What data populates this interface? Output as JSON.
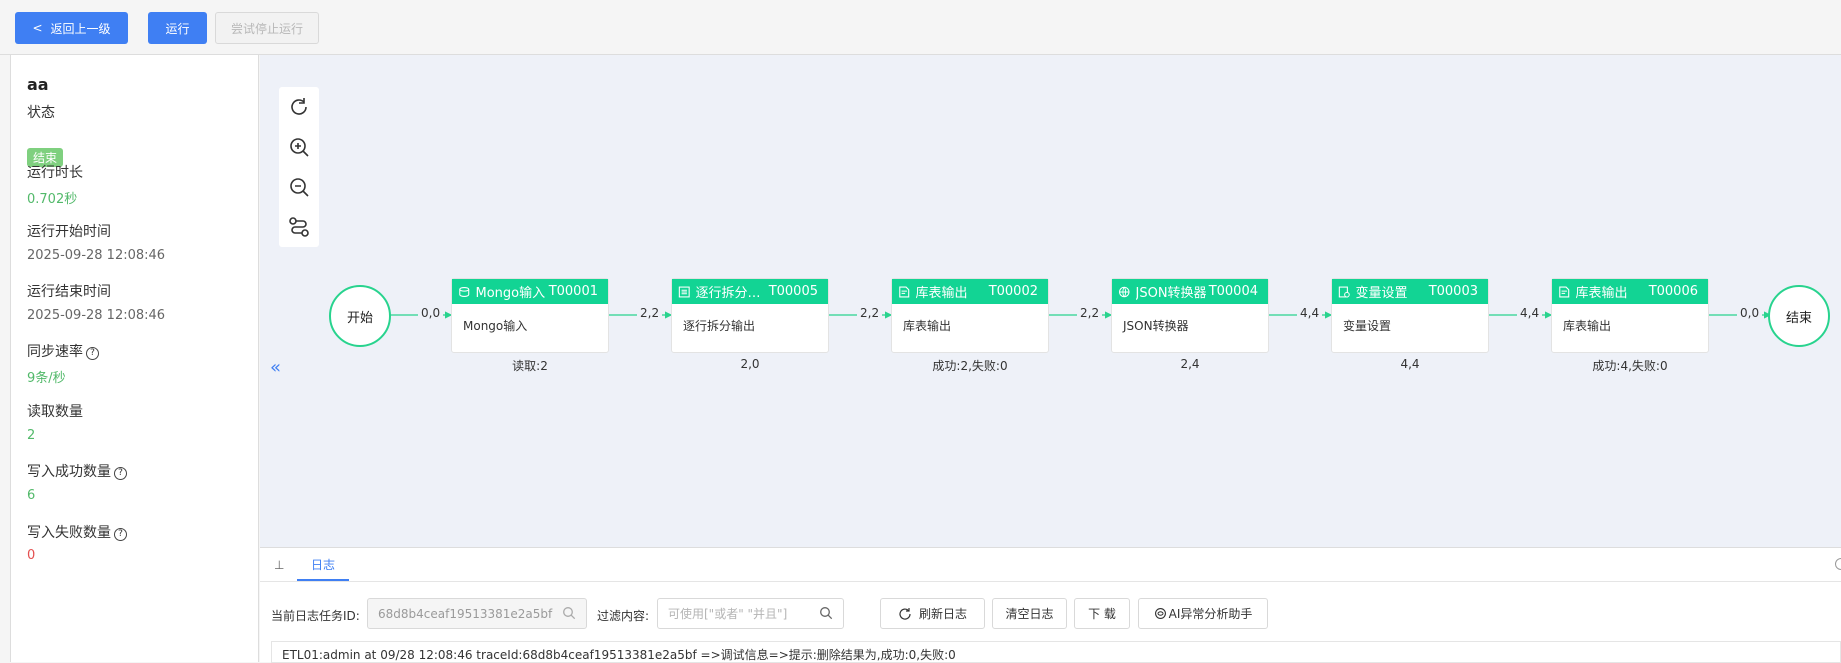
{
  "toolbar": {
    "back_label": "返回上一级",
    "run_label": "运行",
    "stop_label": "尝试停止运行"
  },
  "info": {
    "name": "aa",
    "status_label": "状态",
    "status_value": "结束",
    "duration_label": "运行时长",
    "duration_value": "0.702秒",
    "start_label": "运行开始时间",
    "start_value": "2025-09-28 12:08:46",
    "end_label": "运行结束时间",
    "end_value": "2025-09-28 12:08:46",
    "rate_label": "同步速率",
    "rate_value": "9条/秒",
    "read_label": "读取数量",
    "read_value": "2",
    "write_ok_label": "写入成功数量",
    "write_ok_value": "6",
    "write_fail_label": "写入失败数量",
    "write_fail_value": "0"
  },
  "canvas": {
    "collapse_symbol": "«",
    "start_label": "开始",
    "end_label": "结束",
    "edges": [
      "0,0",
      "2,2",
      "2,2",
      "2,2",
      "4,4",
      "4,4",
      "0,0"
    ],
    "nodes": [
      {
        "name": "Mongo输入",
        "code": "T00001",
        "body": "Mongo输入",
        "stat": "读取:2",
        "icon": "database-icon"
      },
      {
        "name": "逐行拆分输出",
        "code": "T00005",
        "body": "逐行拆分输出",
        "stat": "2,0",
        "icon": "split-icon"
      },
      {
        "name": "库表输出",
        "code": "T00002",
        "body": "库表输出",
        "stat": "成功:2,失败:0",
        "icon": "table-output-icon"
      },
      {
        "name": "JSON转换器",
        "code": "T00004",
        "body": "JSON转换器",
        "stat": "2,4",
        "icon": "json-icon"
      },
      {
        "name": "变量设置",
        "code": "T00003",
        "body": "变量设置",
        "stat": "4,4",
        "icon": "variable-icon"
      },
      {
        "name": "库表输出",
        "code": "T00006",
        "body": "库表输出",
        "stat": "成功:4,失败:0",
        "icon": "table-output-icon"
      }
    ]
  },
  "log": {
    "tab_label": "日志",
    "task_id_label": "当前日志任务ID:",
    "task_id_value": "68d8b4ceaf19513381e2a5bf",
    "filter_label": "过滤内容:",
    "filter_placeholder": "可使用[\"或者\" \"并且\"]",
    "refresh_label": "刷新日志",
    "clear_label": "清空日志",
    "download_label": "下 载",
    "ai_label": "AI异常分析助手",
    "line": "ETL01:admin at 09/28 12:08:46 traceId:68d8b4ceaf19513381e2a5bf =>调试信息=>提示:删除结果为,成功:0,失败:0"
  },
  "colors": {
    "primary": "#3f7ff3",
    "node_header": "#12d494",
    "success": "#52b96a",
    "danger": "#e45050"
  }
}
